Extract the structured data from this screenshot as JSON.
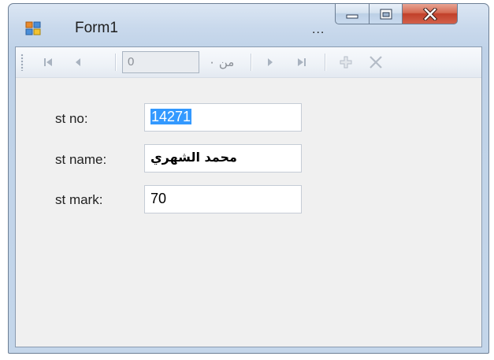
{
  "window": {
    "title": "Form1",
    "title_overflow": "...",
    "buttons": {
      "minimize_icon": "minimize-icon",
      "maximize_icon": "maximize-icon",
      "close_icon": "close-icon"
    },
    "app_icon": "form-app-icon"
  },
  "navigator": {
    "first_icon": "move-first-icon",
    "previous_icon": "move-previous-icon",
    "position_value": "0",
    "count_label": "من ٠",
    "next_icon": "move-next-icon",
    "last_icon": "move-last-icon",
    "add_icon": "add-new-icon",
    "delete_icon": "delete-icon"
  },
  "form": {
    "fields": [
      {
        "label": "st no:",
        "value": "14271",
        "selected": true
      },
      {
        "label": "st name:",
        "value": "محمد الشهري"
      },
      {
        "label": "st mark:",
        "value": "70"
      }
    ]
  },
  "colors": {
    "selection": "#3399ff",
    "close_button": "#c1402a",
    "chrome": "#c4d6ea",
    "client": "#f0f0f0"
  }
}
